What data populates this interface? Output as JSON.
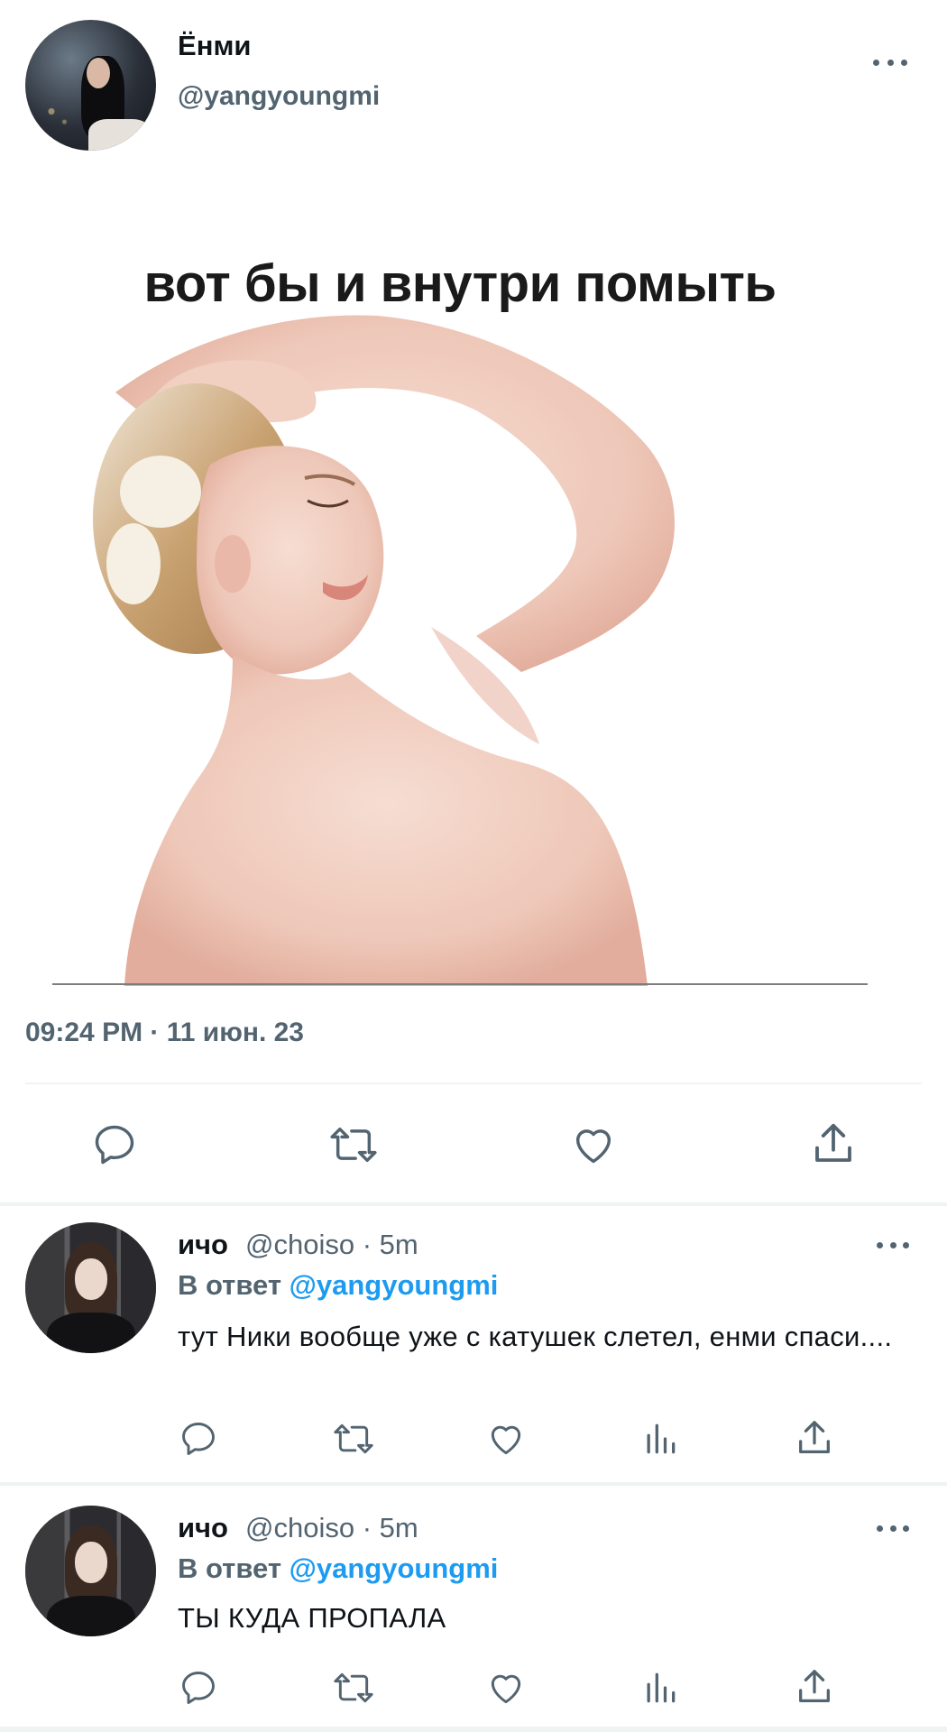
{
  "main_tweet": {
    "author_name": "Ёнми",
    "author_handle": "@yangyoungmi",
    "meme_caption": "вот бы и внутри помыть",
    "timestamp": "09:24 PM · 11 июн. 23",
    "actions": [
      "reply-icon",
      "retweet-icon",
      "like-icon",
      "share-icon"
    ]
  },
  "replies": [
    {
      "author_name": "ичо",
      "author_handle": "@choiso",
      "time": "5m",
      "reply_prefix": "В ответ",
      "reply_mention": "@yangyoungmi",
      "text": "тут Ники вообще уже с катушек слетел, енми спаси....",
      "actions": [
        "reply-icon",
        "retweet-icon",
        "like-icon",
        "analytics-icon",
        "share-icon"
      ]
    },
    {
      "author_name": "ичо",
      "author_handle": "@choiso",
      "time": "5m",
      "reply_prefix": "В ответ",
      "reply_mention": "@yangyoungmi",
      "text": "ТЫ КУДА ПРОПАЛА",
      "actions": [
        "reply-icon",
        "retweet-icon",
        "like-icon",
        "analytics-icon",
        "share-icon"
      ]
    }
  ],
  "colors": {
    "text_primary": "#0f1419",
    "text_secondary": "#536471",
    "mention": "#1d9bf0",
    "divider": "#eff3f4"
  }
}
